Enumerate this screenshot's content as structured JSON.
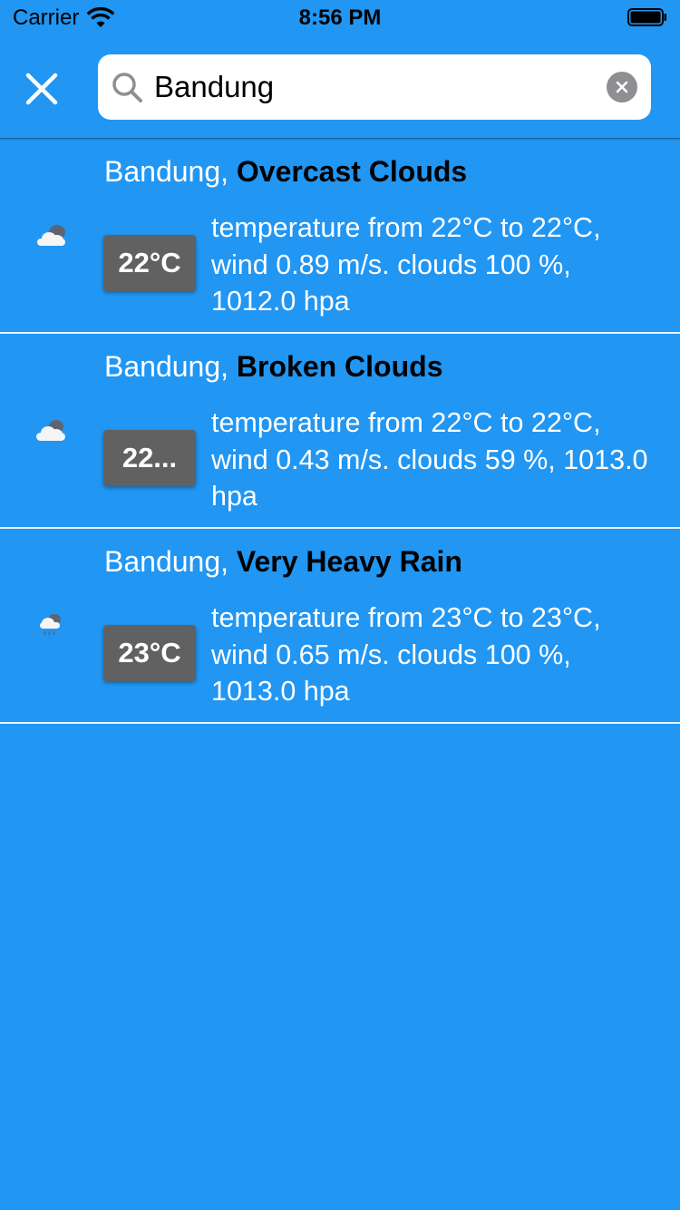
{
  "status_bar": {
    "carrier": "Carrier",
    "time": "8:56 PM"
  },
  "search": {
    "query": "Bandung",
    "placeholder": ""
  },
  "results": [
    {
      "city": "Bandung, ",
      "condition": "Overcast Clouds",
      "temp": "22°C",
      "description": "temperature from 22°C to 22°C, wind 0.89 m/s. clouds 100 %, 1012.0 hpa",
      "icon": "overcast-clouds-icon"
    },
    {
      "city": "Bandung, ",
      "condition": "Broken Clouds",
      "temp": "22...",
      "description": "temperature from 22°C to 22°C, wind 0.43 m/s. clouds 59 %, 1013.0 hpa",
      "icon": "broken-clouds-icon"
    },
    {
      "city": "Bandung, ",
      "condition": "Very Heavy Rain",
      "temp": "23°C",
      "description": "temperature from 23°C to 23°C, wind 0.65 m/s. clouds 100 %, 1013.0 hpa",
      "icon": "heavy-rain-icon"
    }
  ],
  "colors": {
    "background": "#2196F3",
    "badge": "#616161",
    "clear_button": "#8e8e93"
  }
}
